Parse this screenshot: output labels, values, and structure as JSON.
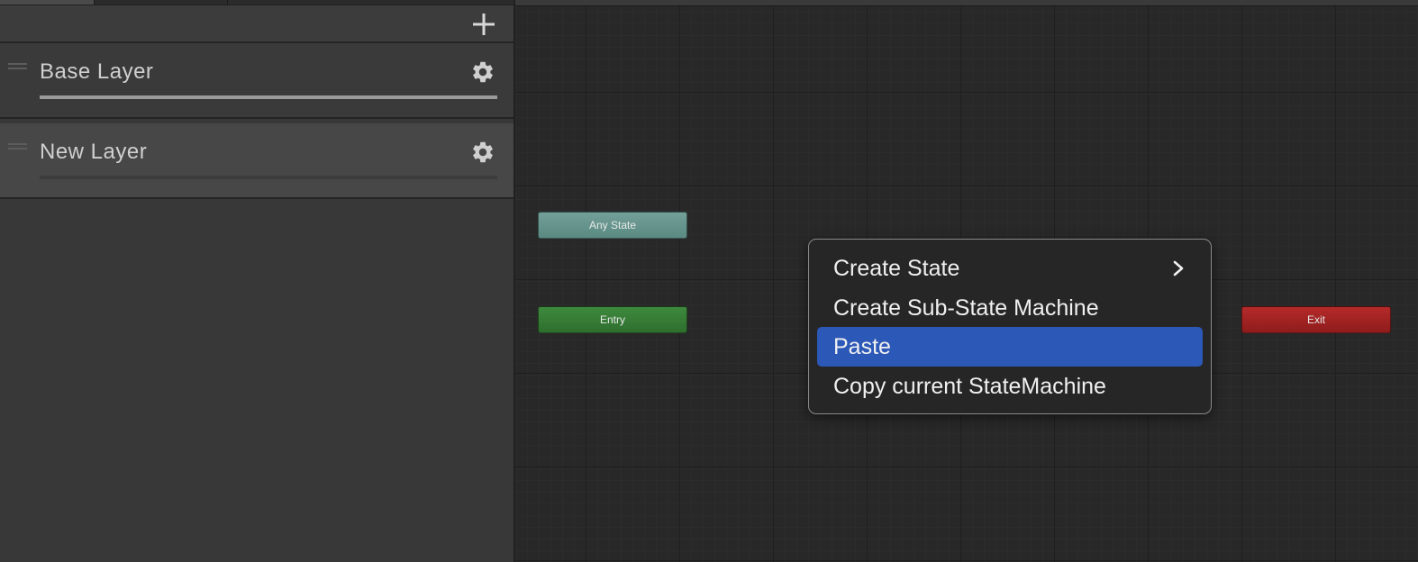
{
  "layers_panel": {
    "add_icon": "plus-icon",
    "layers": [
      {
        "name": "Base Layer",
        "settings_icon": "gear-icon",
        "weight": 1.0
      },
      {
        "name": "New Layer",
        "settings_icon": "gear-icon",
        "weight": 0.0
      }
    ]
  },
  "graph": {
    "nodes": {
      "any_state": "Any State",
      "entry": "Entry",
      "exit": "Exit"
    }
  },
  "context_menu": {
    "items": [
      {
        "label": "Create State",
        "has_submenu": true,
        "submenu_icon": "chevron-right-icon"
      },
      {
        "label": "Create Sub-State Machine",
        "has_submenu": false
      },
      {
        "label": "Paste",
        "highlighted": true
      },
      {
        "label": "Copy current StateMachine",
        "has_submenu": false
      }
    ]
  },
  "colors": {
    "any_state_node": "#5f8f87",
    "entry_node": "#357a35",
    "exit_node": "#a12323",
    "menu_highlight": "#2c58b7"
  }
}
